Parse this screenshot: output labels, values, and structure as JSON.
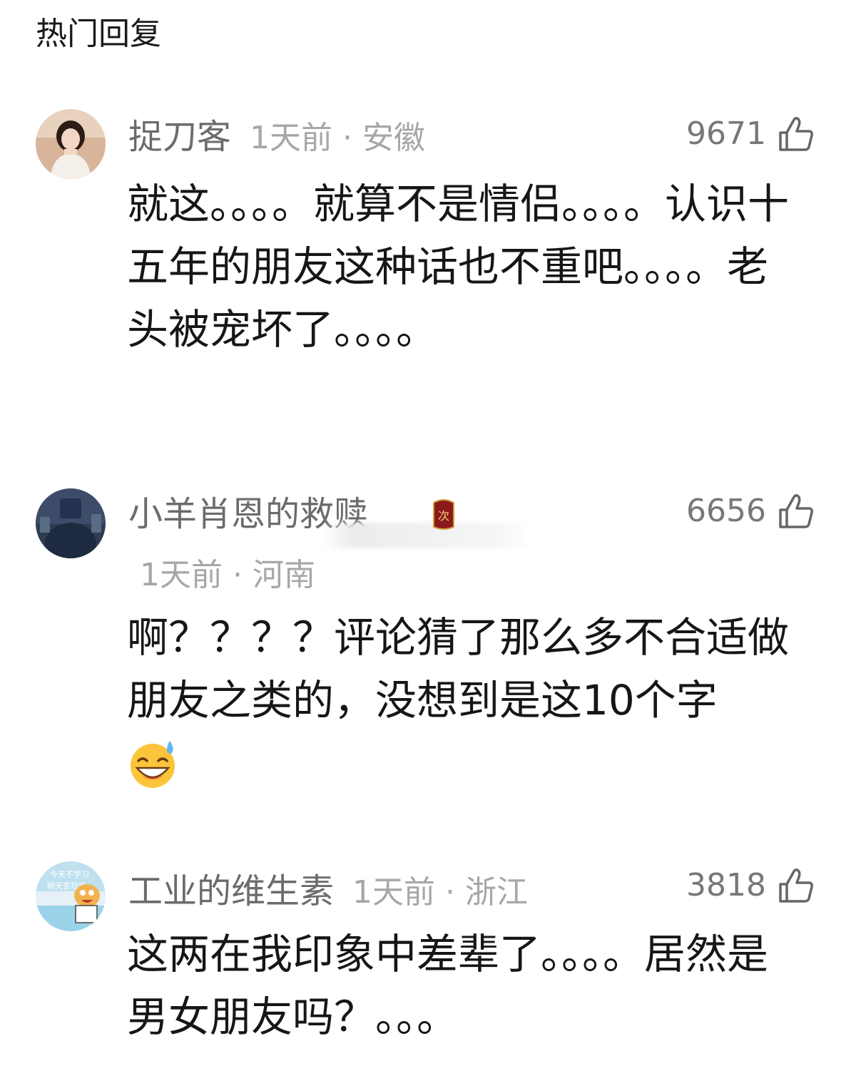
{
  "section": {
    "title": "热门回复"
  },
  "comments": [
    {
      "username": "捉刀客",
      "time_location": "1天前 · 安徽",
      "likes": "9671",
      "text": "就这。。。。就算不是情侣。。。。认识十五年的朋友这种话也不重吧。。。。老头被宠坏了。。。。",
      "avatar_icon": "user-avatar-girl-photo",
      "like_icon": "thumbs-up-icon"
    },
    {
      "username": "小羊肖恩的救赎",
      "time_location": "1天前 · 河南",
      "likes": "6656",
      "text": "啊？？？？评论猜了那么多不合适做朋友之类的，没想到是这10个字",
      "badge_text": "次",
      "emoji_icon": "grinning-sweat-emoji",
      "avatar_icon": "user-avatar-dark-figure",
      "like_icon": "thumbs-up-icon"
    },
    {
      "username": "工业的维生素",
      "time_location": "1天前 · 浙江",
      "likes": "3818",
      "text": "这两在我印象中差辈了。。。。居然是男女朋友吗？。。。",
      "avatar_text": "今天不学习 明天变垃圾",
      "avatar_icon": "user-avatar-cartoon",
      "like_icon": "thumbs-up-icon"
    }
  ],
  "colors": {
    "username": "#6b6b6b",
    "meta": "#a7a7a7",
    "body": "#161616",
    "badge": "#8b1a1a"
  }
}
